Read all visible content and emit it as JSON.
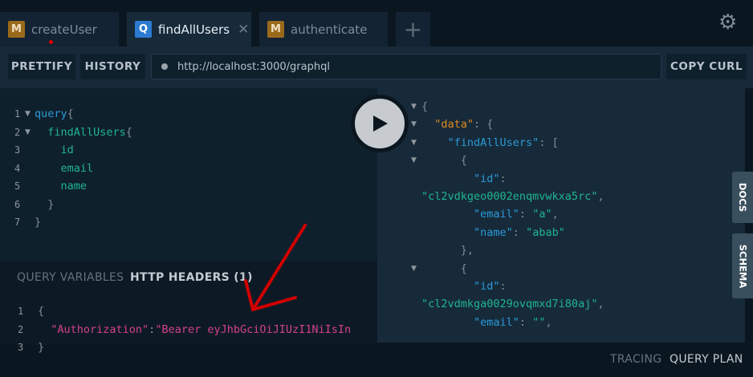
{
  "tabs": [
    {
      "badge": "M",
      "label": "createUser",
      "unsaved": true
    },
    {
      "badge": "Q",
      "label": "findAllUsers",
      "active": true
    },
    {
      "badge": "M",
      "label": "authenticate"
    }
  ],
  "toolbar": {
    "prettify": "PRETTIFY",
    "history": "HISTORY",
    "url": "http://localhost:3000/graphql",
    "copy_curl": "COPY CURL"
  },
  "query_lines": [
    {
      "n": "1",
      "fold": true,
      "parts": [
        [
          "kw",
          "query"
        ],
        [
          "pn",
          "{"
        ]
      ]
    },
    {
      "n": "2",
      "fold": true,
      "parts": [
        [
          "fld",
          "  findAllUsers"
        ],
        [
          "pn",
          "{"
        ]
      ]
    },
    {
      "n": "3",
      "parts": [
        [
          "fld",
          "    id"
        ]
      ]
    },
    {
      "n": "4",
      "parts": [
        [
          "fld",
          "    email"
        ]
      ]
    },
    {
      "n": "5",
      "parts": [
        [
          "fld",
          "    name"
        ]
      ]
    },
    {
      "n": "6",
      "parts": [
        [
          "pn",
          "  }"
        ]
      ]
    },
    {
      "n": "7",
      "parts": [
        [
          "pn",
          "}"
        ]
      ]
    }
  ],
  "variables": {
    "tab_query_variables": "QUERY VARIABLES",
    "tab_http_headers": "HTTP HEADERS (1)"
  },
  "header_lines": [
    {
      "n": "1",
      "parts": [
        [
          "pn",
          "{"
        ]
      ]
    },
    {
      "n": "2",
      "parts": [
        [
          "hd",
          "  \"Authorization\""
        ],
        [
          "pn",
          ":"
        ],
        [
          "hd",
          "\"Bearer eyJhbGciOiJIUzI1NiIsIn"
        ]
      ]
    },
    {
      "n": "3",
      "parts": [
        [
          "pn",
          "}"
        ]
      ]
    }
  ],
  "response_lines": [
    {
      "fold": true,
      "parts": [
        [
          "pn",
          "{"
        ]
      ]
    },
    {
      "fold": true,
      "parts": [
        [
          "dk",
          "  \"data\""
        ],
        [
          "pn",
          ": {"
        ]
      ]
    },
    {
      "fold": true,
      "parts": [
        [
          "key",
          "    \"findAllUsers\""
        ],
        [
          "pn",
          ": ["
        ]
      ]
    },
    {
      "fold": true,
      "parts": [
        [
          "pn",
          "      {"
        ]
      ]
    },
    {
      "parts": [
        [
          "key",
          "        \"id\""
        ],
        [
          "pn",
          ":"
        ]
      ]
    },
    {
      "parts": [
        [
          "str",
          "\"cl2vdkgeo0002enqmvwkxa5rc\""
        ],
        [
          "pn",
          ","
        ]
      ]
    },
    {
      "parts": [
        [
          "key",
          "        \"email\""
        ],
        [
          "pn",
          ": "
        ],
        [
          "str",
          "\"a\""
        ],
        [
          "pn",
          ","
        ]
      ]
    },
    {
      "parts": [
        [
          "key",
          "        \"name\""
        ],
        [
          "pn",
          ": "
        ],
        [
          "str",
          "\"abab\""
        ]
      ]
    },
    {
      "parts": [
        [
          "pn",
          "      },"
        ]
      ]
    },
    {
      "fold": true,
      "parts": [
        [
          "pn",
          "      {"
        ]
      ]
    },
    {
      "parts": [
        [
          "key",
          "        \"id\""
        ],
        [
          "pn",
          ":"
        ]
      ]
    },
    {
      "parts": [
        [
          "str",
          "\"cl2vdmkga0029ovqmxd7i80aj\""
        ],
        [
          "pn",
          ","
        ]
      ]
    },
    {
      "parts": [
        [
          "key",
          "        \"email\""
        ],
        [
          "pn",
          ": "
        ],
        [
          "str",
          "\"\""
        ],
        [
          "pn",
          ","
        ]
      ]
    }
  ],
  "side_tabs": {
    "docs": "DOCS",
    "schema": "SCHEMA"
  },
  "footer": {
    "tracing": "TRACING",
    "query_plan": "QUERY PLAN"
  },
  "colors": {
    "annotation_arrow": "#d00000",
    "unsaved_dot": "#e00000"
  }
}
